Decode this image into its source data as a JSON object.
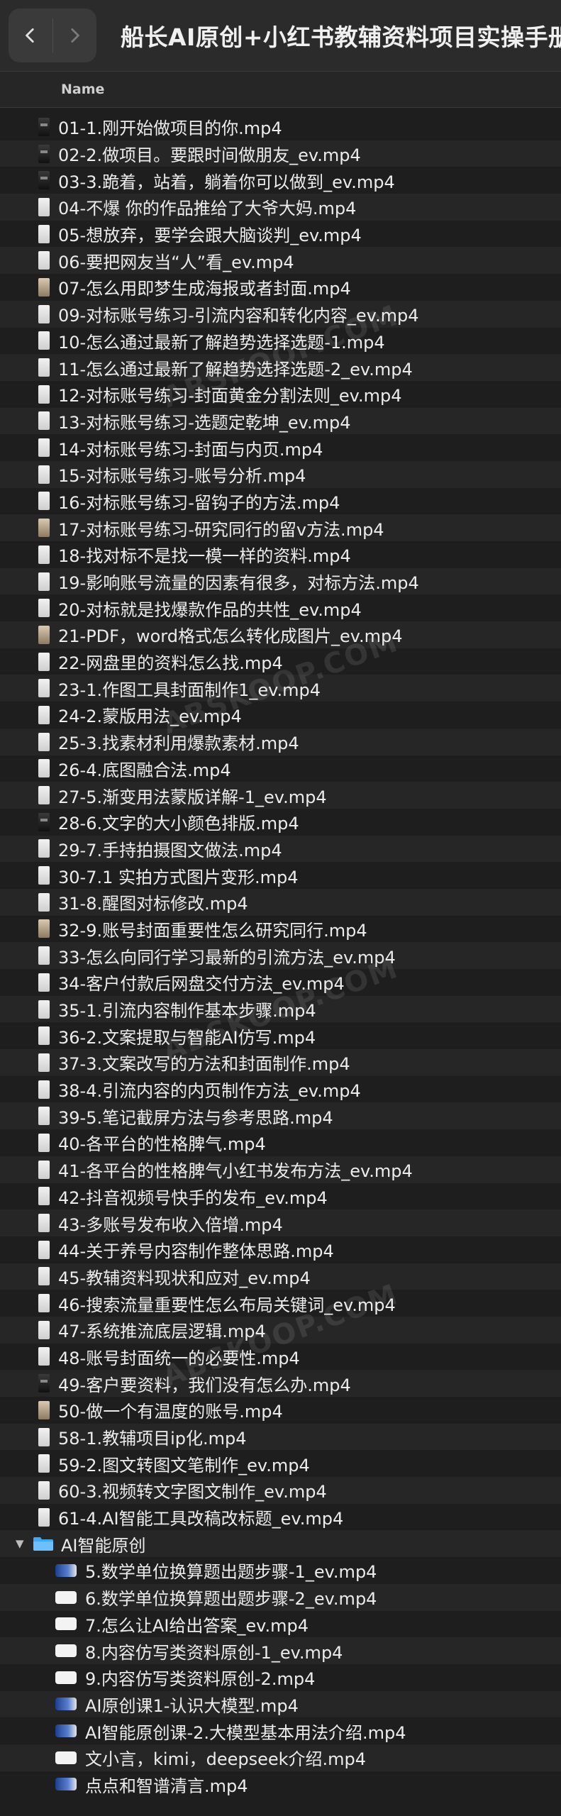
{
  "window": {
    "title": "船长AI原创+小红书教辅资料项目实操手册",
    "back_icon": "chevron-left-icon",
    "forward_icon": "chevron-right-icon"
  },
  "column_header": {
    "name": "Name"
  },
  "files": [
    {
      "name": "01-1.刚开始做项目的你.mp4",
      "thumb": "dark"
    },
    {
      "name": "02-2.做项目。要跟时间做朋友_ev.mp4",
      "thumb": "dark"
    },
    {
      "name": "03-3.跪着，站着，躺着你可以做到_ev.mp4",
      "thumb": "dark"
    },
    {
      "name": "04-不爆 你的作品推给了大爷大妈.mp4",
      "thumb": "light"
    },
    {
      "name": "05-想放弃，要学会跟大脑谈判_ev.mp4",
      "thumb": "light"
    },
    {
      "name": "06-要把网友当“人”看_ev.mp4",
      "thumb": "light"
    },
    {
      "name": "07-怎么用即梦生成海报或者封面.mp4",
      "thumb": "brown"
    },
    {
      "name": "09-对标账号练习-引流内容和转化内容_ev.mp4",
      "thumb": "light"
    },
    {
      "name": "10-怎么通过最新了解趋势选择选题-1.mp4",
      "thumb": "light"
    },
    {
      "name": "11-怎么通过最新了解趋势选择选题-2_ev.mp4",
      "thumb": "light"
    },
    {
      "name": "12-对标账号练习-封面黄金分割法则_ev.mp4",
      "thumb": "light"
    },
    {
      "name": "13-对标账号练习-选题定乾坤_ev.mp4",
      "thumb": "light"
    },
    {
      "name": "14-对标账号练习-封面与内页.mp4",
      "thumb": "light"
    },
    {
      "name": "15-对标账号练习-账号分析.mp4",
      "thumb": "light"
    },
    {
      "name": "16-对标账号练习-留钩子的方法.mp4",
      "thumb": "light"
    },
    {
      "name": "17-对标账号练习-研究同行的留v方法.mp4",
      "thumb": "brown"
    },
    {
      "name": "18-找对标不是找一模一样的资料.mp4",
      "thumb": "light"
    },
    {
      "name": "19-影响账号流量的因素有很多，对标方法.mp4",
      "thumb": "light"
    },
    {
      "name": "20-对标就是找爆款作品的共性_ev.mp4",
      "thumb": "light"
    },
    {
      "name": "21-PDF，word格式怎么转化成图片_ev.mp4",
      "thumb": "brown"
    },
    {
      "name": "22-网盘里的资料怎么找.mp4",
      "thumb": "light"
    },
    {
      "name": "23-1.作图工具封面制作1_ev.mp4",
      "thumb": "light"
    },
    {
      "name": "24-2.蒙版用法_ev.mp4",
      "thumb": "light"
    },
    {
      "name": "25-3.找素材利用爆款素材.mp4",
      "thumb": "light"
    },
    {
      "name": "26-4.底图融合法.mp4",
      "thumb": "light"
    },
    {
      "name": "27-5.渐变用法蒙版详解-1_ev.mp4",
      "thumb": "light"
    },
    {
      "name": "28-6.文字的大小颜色排版.mp4",
      "thumb": "dark"
    },
    {
      "name": "29-7.手持拍摄图文做法.mp4",
      "thumb": "light"
    },
    {
      "name": "30-7.1 实拍方式图片变形.mp4",
      "thumb": "light"
    },
    {
      "name": "31-8.醒图对标修改.mp4",
      "thumb": "light"
    },
    {
      "name": "32-9.账号封面重要性怎么研究同行.mp4",
      "thumb": "brown"
    },
    {
      "name": "33-怎么向同行学习最新的引流方法_ev.mp4",
      "thumb": "light"
    },
    {
      "name": "34-客户付款后网盘交付方法_ev.mp4",
      "thumb": "light"
    },
    {
      "name": "35-1.引流内容制作基本步骤.mp4",
      "thumb": "light"
    },
    {
      "name": "36-2.文案提取与智能AI仿写.mp4",
      "thumb": "light"
    },
    {
      "name": "37-3.文案改写的方法和封面制作.mp4",
      "thumb": "light"
    },
    {
      "name": "38-4.引流内容的内页制作方法_ev.mp4",
      "thumb": "light"
    },
    {
      "name": "39-5.笔记截屏方法与参考思路.mp4",
      "thumb": "light"
    },
    {
      "name": "40-各平台的性格脾气.mp4",
      "thumb": "light"
    },
    {
      "name": "41-各平台的性格脾气小红书发布方法_ev.mp4",
      "thumb": "light"
    },
    {
      "name": "42-抖音视频号快手的发布_ev.mp4",
      "thumb": "light"
    },
    {
      "name": "43-多账号发布收入倍增.mp4",
      "thumb": "light"
    },
    {
      "name": "44-关于养号内容制作整体思路.mp4",
      "thumb": "light"
    },
    {
      "name": "45-教辅资料现状和应对_ev.mp4",
      "thumb": "light"
    },
    {
      "name": "46-搜索流量重要性怎么布局关键词_ev.mp4",
      "thumb": "light"
    },
    {
      "name": "47-系统推流底层逻辑.mp4",
      "thumb": "light"
    },
    {
      "name": "48-账号封面统一的必要性.mp4",
      "thumb": "light"
    },
    {
      "name": "49-客户要资料，我们没有怎么办.mp4",
      "thumb": "dark"
    },
    {
      "name": "50-做一个有温度的账号.mp4",
      "thumb": "brown"
    },
    {
      "name": "58-1.教辅项目ip化.mp4",
      "thumb": "light"
    },
    {
      "name": "59-2.图文转图文笔制作_ev.mp4",
      "thumb": "light"
    },
    {
      "name": "60-3.视频转文字图文制作_ev.mp4",
      "thumb": "light"
    },
    {
      "name": "61-4.AI智能工具改稿改标题_ev.mp4",
      "thumb": "light"
    }
  ],
  "folder": {
    "name": "AI智能原创",
    "icon": "folder-icon",
    "expanded_icon": "chevron-down-icon",
    "accent": "#3fa9f5",
    "items": [
      {
        "name": "5.数学单位换算题出题步骤-1_ev.mp4",
        "thumb": "vid"
      },
      {
        "name": "6.数学单位换算题出题步骤-2_ev.mp4",
        "thumb": "white"
      },
      {
        "name": "7.怎么让AI给出答案_ev.mp4",
        "thumb": "white"
      },
      {
        "name": "8.内容仿写类资料原创-1_ev.mp4",
        "thumb": "white"
      },
      {
        "name": "9.内容仿写类资料原创-2.mp4",
        "thumb": "white"
      },
      {
        "name": "AI原创课1-认识大模型.mp4",
        "thumb": "vid"
      },
      {
        "name": "AI智能原创课-2.大模型基本用法介绍.mp4",
        "thumb": "vid"
      },
      {
        "name": "文小言，kimi，deepseek介绍.mp4",
        "thumb": "white"
      },
      {
        "name": "点点和智谱清言.mp4",
        "thumb": "vid"
      }
    ]
  },
  "watermark": {
    "text": "ABSKOOP.COM"
  },
  "colors": {
    "background": "#1e1e1e",
    "titlebar": "#2b2b2b",
    "row_alt": "#262626",
    "text": "#ececec"
  }
}
